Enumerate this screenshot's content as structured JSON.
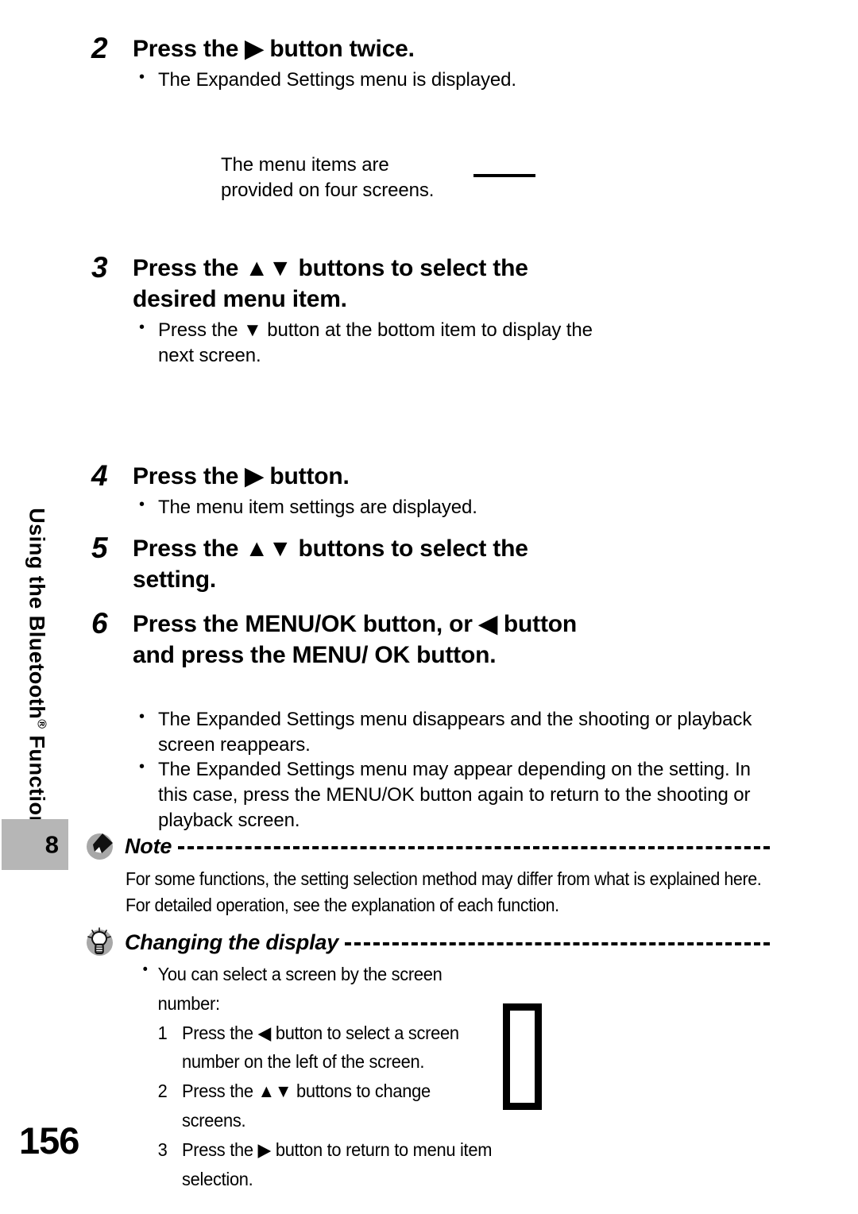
{
  "sidebar": {
    "chapter_title": "Using the Bluetooth",
    "chapter_title_sup": "®",
    "chapter_title_tail": " Function",
    "chapter_number": "8",
    "page_number": "156"
  },
  "steps": [
    {
      "number": "2",
      "heading": "Press the ▶ button twice.",
      "bullets": [
        "The Expanded Settings menu is displayed."
      ]
    },
    {
      "number": "3",
      "heading": "Press the ▲▼ buttons to select the desired menu item.",
      "bullets": [
        "Press the ▼ button at the bottom item to display the next screen."
      ]
    },
    {
      "number": "4",
      "heading": "Press the ▶ button.",
      "bullets": [
        "The menu item settings are displayed."
      ]
    },
    {
      "number": "5",
      "heading": "Press the ▲▼ buttons to select the setting.",
      "bullets": []
    },
    {
      "number": "6",
      "heading": "Press the MENU/OK button, or ◀ button and press the MENU/ OK button.",
      "bullets": [
        "The Expanded Settings menu disappears and the shooting or playback screen reappears.",
        "The Expanded Settings menu may appear depending on the setting. In this case, press the MENU/OK button again to return to the shooting or playback screen."
      ]
    }
  ],
  "float_note": "The menu items are\nprovided on four screens.",
  "note_block": {
    "title": "Note",
    "icon": "pencil-note-icon",
    "body_lines": [
      "For some functions, the setting selection method may differ from what is explained here.",
      "For detailed operation, see the explanation of each function."
    ]
  },
  "tip_block": {
    "title": "Changing the display",
    "icon": "lightbulb-icon",
    "bullet": "You can select a screen by the screen number:",
    "numbered": [
      {
        "n": "1",
        "text": "Press the ◀ button to select a screen number on the left of the screen."
      },
      {
        "n": "2",
        "text": "Press the ▲▼ buttons to change screens."
      },
      {
        "n": "3",
        "text": "Press the ▶ button to return to menu item selection."
      }
    ]
  }
}
